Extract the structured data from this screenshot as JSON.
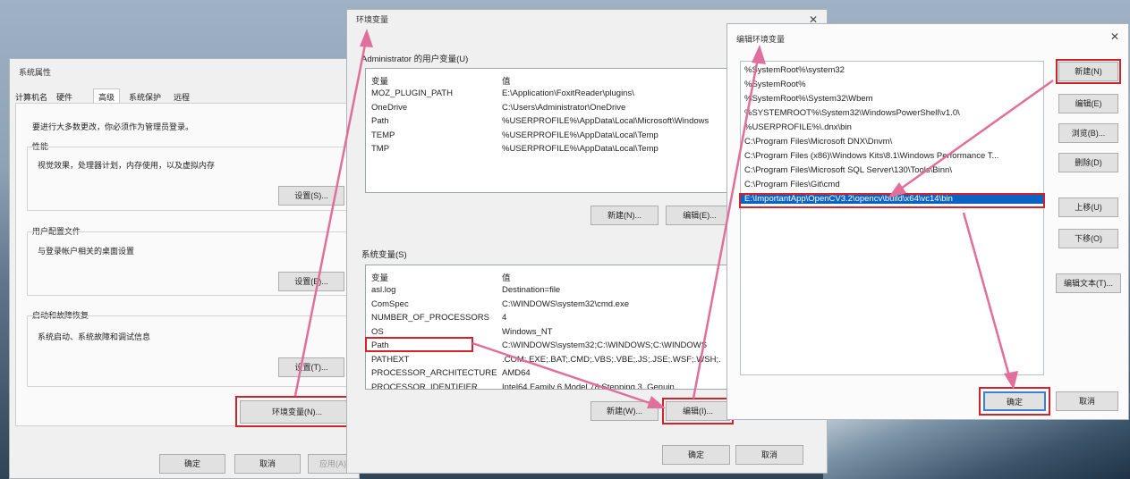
{
  "sysprops": {
    "title": "系统属性",
    "tabs": [
      "计算机名",
      "硬件",
      "高级",
      "系统保护",
      "远程"
    ],
    "admin_note": "要进行大多数更改，你必须作为管理员登录。",
    "performance": {
      "label": "性能",
      "desc": "视觉效果，处理器计划，内存使用，以及虚拟内存",
      "button": "设置(S)..."
    },
    "profile": {
      "label": "用户配置文件",
      "desc": "与登录帐户相关的桌面设置",
      "button": "设置(E)..."
    },
    "startup": {
      "label": "启动和故障恢复",
      "desc": "系统启动、系统故障和调试信息",
      "button": "设置(T)..."
    },
    "env_button": "环境变量(N)...",
    "ok": "确定",
    "cancel": "取消",
    "apply": "应用(A)"
  },
  "envvars": {
    "title": "环境变量",
    "user_header": "Administrator 的用户变量(U)",
    "col_var": "变量",
    "col_val": "值",
    "user_vars": [
      {
        "name": "MOZ_PLUGIN_PATH",
        "value": "E:\\Application\\FoxitReader\\plugins\\"
      },
      {
        "name": "OneDrive",
        "value": "C:\\Users\\Administrator\\OneDrive"
      },
      {
        "name": "Path",
        "value": "%USERPROFILE%\\AppData\\Local\\Microsoft\\Windows"
      },
      {
        "name": "TEMP",
        "value": "%USERPROFILE%\\AppData\\Local\\Temp"
      },
      {
        "name": "TMP",
        "value": "%USERPROFILE%\\AppData\\Local\\Temp"
      }
    ],
    "user_new": "新建(N)...",
    "user_edit": "编辑(E)...",
    "sys_header": "系统变量(S)",
    "sys_vars": [
      {
        "name": "asl.log",
        "value": "Destination=file"
      },
      {
        "name": "ComSpec",
        "value": "C:\\WINDOWS\\system32\\cmd.exe"
      },
      {
        "name": "NUMBER_OF_PROCESSORS",
        "value": "4"
      },
      {
        "name": "OS",
        "value": "Windows_NT"
      },
      {
        "name": "Path",
        "value": "C:\\WINDOWS\\system32;C:\\WINDOWS;C:\\WINDOWS"
      },
      {
        "name": "PATHEXT",
        "value": ".COM;.EXE;.BAT;.CMD;.VBS;.VBE;.JS;.JSE;.WSF;.WSH;."
      },
      {
        "name": "PROCESSOR_ARCHITECTURE",
        "value": "AMD64"
      },
      {
        "name": "PROCESSOR_IDENTIFIER",
        "value": "Intel64 Family 6 Model 78 Stepping 3, Genuin"
      }
    ],
    "sys_new": "新建(W)...",
    "sys_edit": "编辑(I)...",
    "ok": "确定",
    "cancel": "取消"
  },
  "editenv": {
    "title": "编辑环境变量",
    "entries": [
      "%SystemRoot%\\system32",
      "%SystemRoot%",
      "%SystemRoot%\\System32\\Wbem",
      "%SYSTEMROOT%\\System32\\WindowsPowerShell\\v1.0\\",
      "%USERPROFILE%\\.dnx\\bin",
      "C:\\Program Files\\Microsoft DNX\\Dnvm\\",
      "C:\\Program Files (x86)\\Windows Kits\\8.1\\Windows Performance T...",
      "C:\\Program Files\\Microsoft SQL Server\\130\\Tools\\Binn\\",
      "C:\\Program Files\\Git\\cmd",
      "E:\\ImportantApp\\OpenCV3.2\\opencv\\build\\x64\\vc14\\bin"
    ],
    "new": "新建(N)",
    "edit": "编辑(E)",
    "browse": "浏览(B)...",
    "delete": "删除(D)",
    "up": "上移(U)",
    "down": "下移(O)",
    "edit_text": "编辑文本(T)...",
    "ok": "确定",
    "cancel": "取消"
  },
  "colors": {
    "highlight": "#0b63c5",
    "annotation": "#d2232a",
    "arrow": "#e0709b"
  }
}
